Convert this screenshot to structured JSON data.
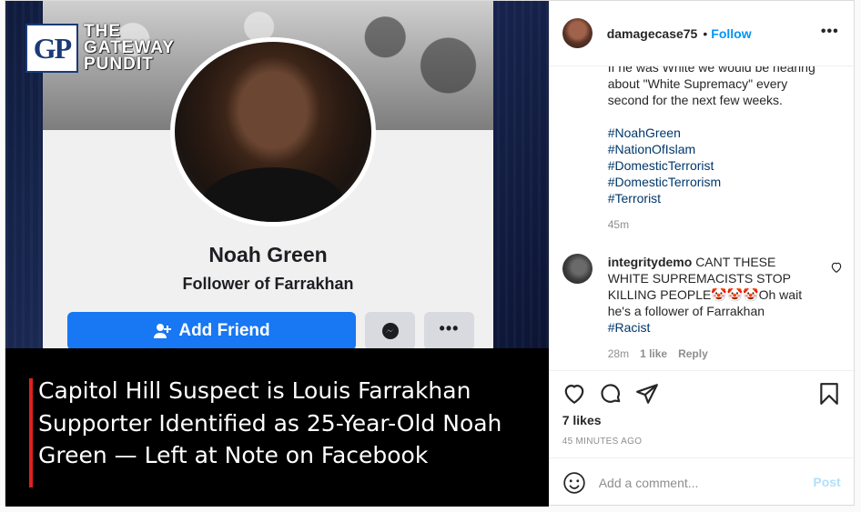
{
  "post_image": {
    "logo_badge": "GP",
    "logo_words": [
      "THE",
      "GATEWAY",
      "PUNDIT"
    ],
    "profile_name": "Noah Green",
    "profile_subtitle": "Follower of Farrakhan",
    "add_friend_label": "Add Friend",
    "more_label": "•••",
    "headline": "Capitol Hill Suspect is Louis Farrakhan Supporter Identified as 25-Year-Old Noah Green — Left at Note on Facebook",
    "colors": {
      "facebook_blue": "#1877f2",
      "accent_red": "#e02020"
    }
  },
  "header": {
    "username": "damagecase75",
    "separator": "•",
    "follow_label": "Follow",
    "more_label": "•••"
  },
  "caption": {
    "lines": [
      "If he was White we would be hearing",
      "about \"White Supremacy\" every",
      "second for the next few weeks."
    ],
    "hashtags": [
      "#NoahGreen",
      "#NationOfIslam",
      "#DomesticTerrorist",
      "#DomesticTerrorism",
      "#Terrorist"
    ],
    "time": "45m"
  },
  "comment": {
    "username": "integritydemo",
    "text": "CANT THESE WHITE SUPREMACISTS STOP KILLING PEOPLE🤡🤡🤡Oh wait he's a follower of Farrakhan",
    "hashtag": "#Racist",
    "time": "28m",
    "likes": "1 like",
    "reply_label": "Reply"
  },
  "actions": {
    "likes": "7 likes",
    "posted_ago": "45 MINUTES AGO"
  },
  "add_comment": {
    "placeholder": "Add a comment...",
    "post_label": "Post"
  },
  "icons": [
    "heart-icon",
    "comment-icon",
    "share-icon",
    "bookmark-icon",
    "emoji-icon",
    "messenger-icon",
    "add-friend-icon"
  ],
  "colors": {
    "link_blue": "#0095f6",
    "hashtag_blue": "#00376b",
    "muted": "#8e8e8e"
  }
}
